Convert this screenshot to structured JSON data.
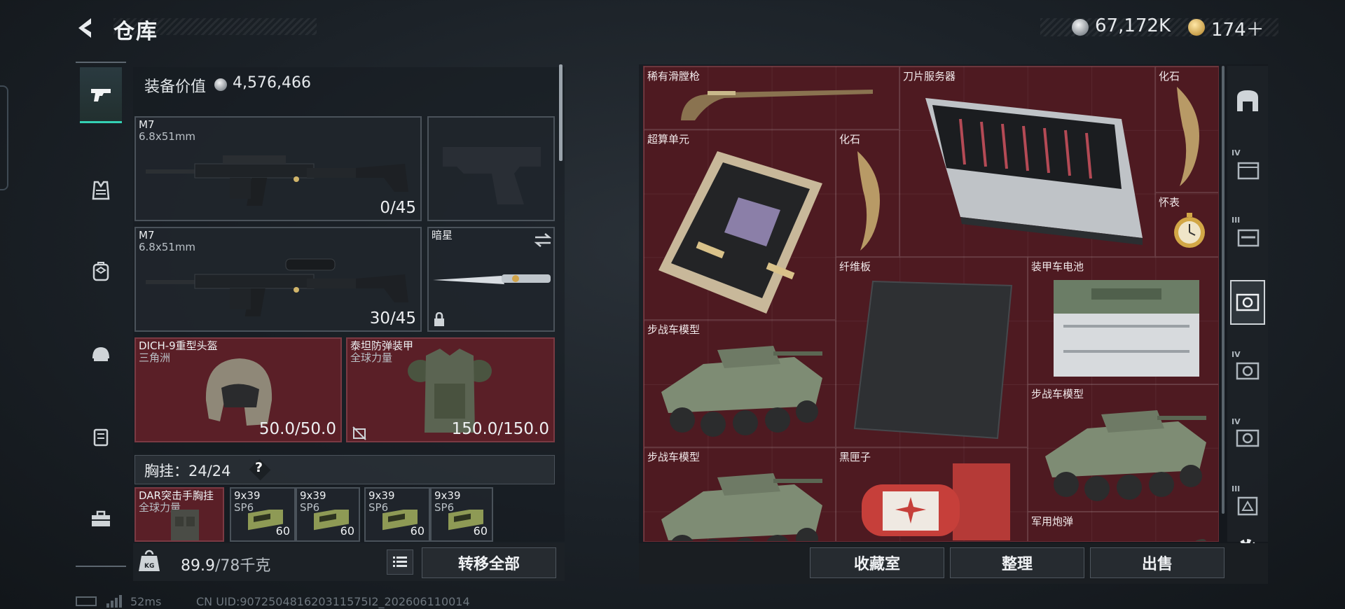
{
  "header": {
    "title": "仓库",
    "currency_silver": "67,172K",
    "currency_gold": "174＋"
  },
  "left": {
    "equip_value_label": "装备价值",
    "equip_value": "4,576,466",
    "primary_weapon": {
      "name": "M7",
      "caliber": "6.8x51mm",
      "ammo": "0/45"
    },
    "secondary_weapon": {
      "name": "M7",
      "caliber": "6.8x51mm",
      "ammo": "30/45"
    },
    "melee": {
      "name": "暗星"
    },
    "helmet": {
      "name": "DICH-9重型头盔",
      "faction": "三角洲",
      "durability": "50.0/50.0"
    },
    "armor": {
      "name": "泰坦防弹装甲",
      "faction": "全球力量",
      "durability": "150.0/150.0"
    },
    "chest_rig_label": "胸挂：24/24",
    "chest_rig_help": "?",
    "rig_item": {
      "name": "DAR突击手胸挂",
      "faction": "全球力量"
    },
    "ammo_slots": [
      {
        "name": "9x39",
        "sub": "SP6",
        "count": "60"
      },
      {
        "name": "9x39",
        "sub": "SP6",
        "count": "60"
      },
      {
        "name": "9x39",
        "sub": "SP6",
        "count": "60"
      },
      {
        "name": "9x39",
        "sub": "SP6",
        "count": "60"
      }
    ],
    "weight": "89.9",
    "weight_capacity": "/78千克",
    "transfer_all": "转移全部"
  },
  "stash": {
    "items": [
      {
        "name": "稀有滑膛枪"
      },
      {
        "name": "刀片服务器"
      },
      {
        "name": "化石"
      },
      {
        "name": "超算单元"
      },
      {
        "name": "化石"
      },
      {
        "name": "怀表"
      },
      {
        "name": "纤维板"
      },
      {
        "name": "装甲车电池"
      },
      {
        "name": "步战车模型"
      },
      {
        "name": "步战车模型"
      },
      {
        "name": "步战车模型"
      },
      {
        "name": "黑匣子"
      },
      {
        "name": "军用炮弹"
      }
    ],
    "buttons": {
      "collection": "收藏室",
      "sort": "整理",
      "sell": "出售"
    }
  },
  "right_rail": {
    "tiers": [
      "IV",
      "III",
      "IV",
      "IV",
      "III"
    ]
  },
  "footer": {
    "ping": "52ms",
    "uid": "CN UID:907250481620311575I2_202606110014"
  },
  "colors": {
    "accent": "#34d1b4",
    "stash_bg": "#4e1a21",
    "slot_red": "#5a1f27"
  }
}
